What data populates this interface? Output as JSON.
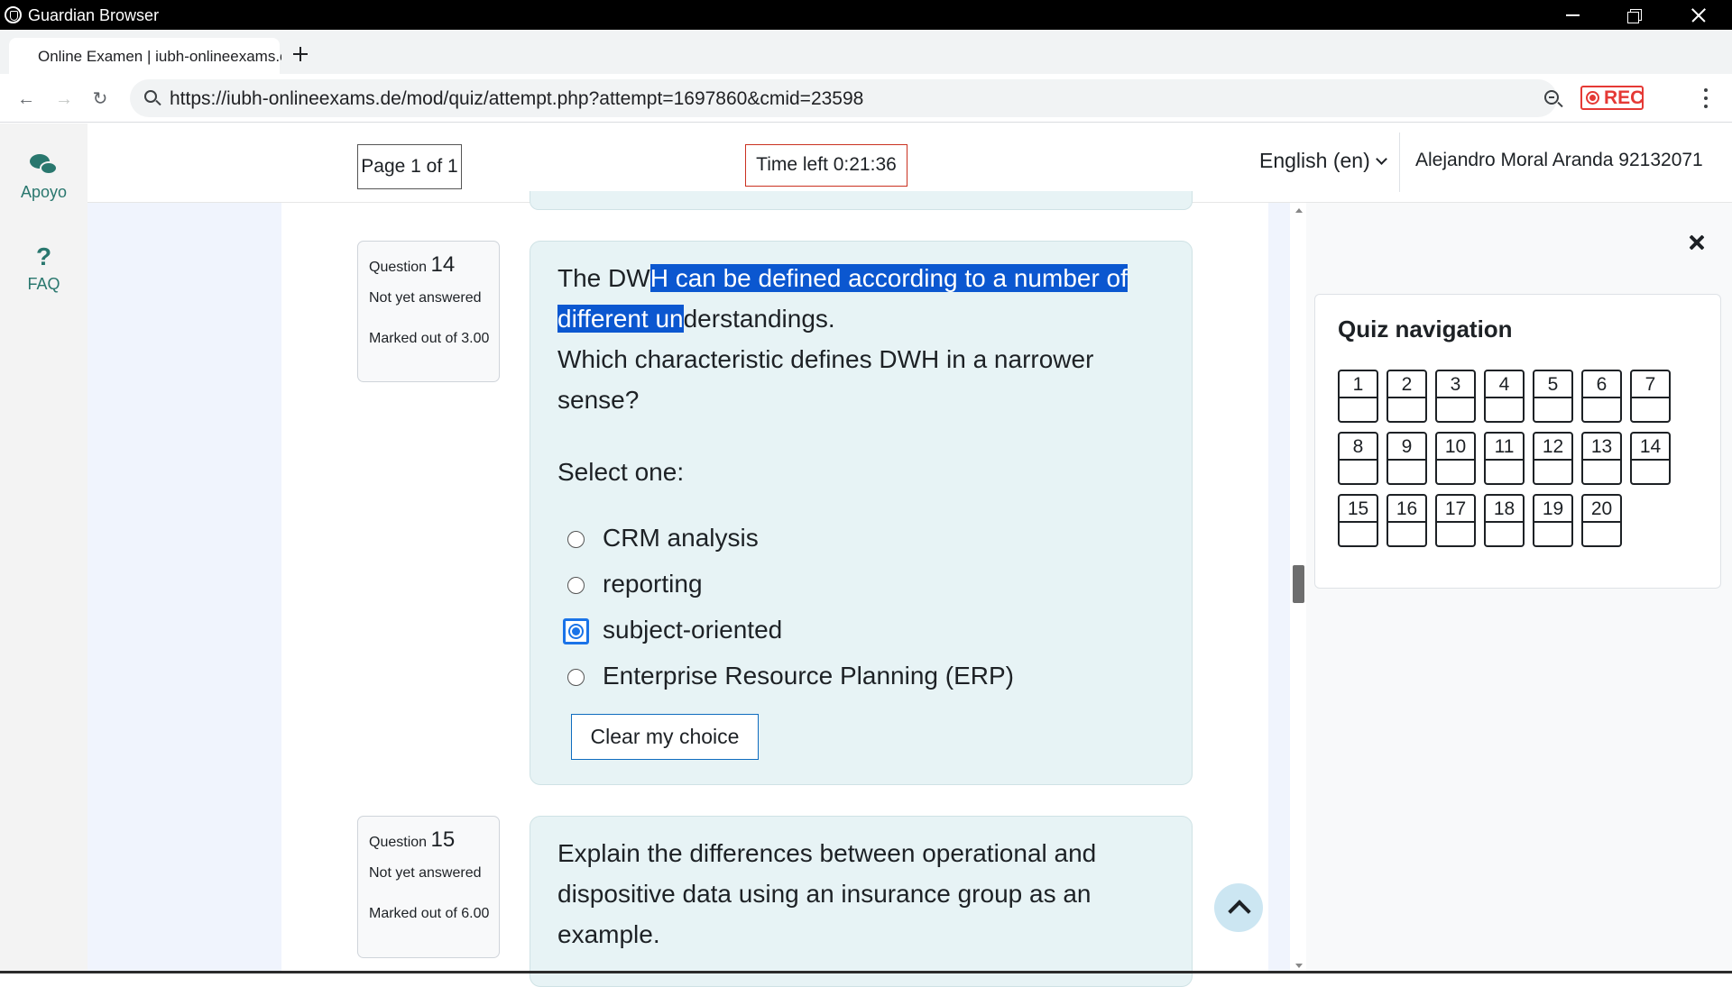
{
  "window": {
    "title": "Guardian Browser"
  },
  "tab": {
    "title": "Online Examen | iubh-onlineexams.c"
  },
  "address": {
    "url": "https://iubh-onlineexams.de/mod/quiz/attempt.php?attempt=1697860&cmid=23598",
    "rec_label": "REC"
  },
  "support": {
    "items": [
      {
        "label": "Apoyo",
        "icon": "chat-icon"
      },
      {
        "label": "FAQ",
        "icon": "question-icon"
      }
    ]
  },
  "header": {
    "page_info": "Page 1 of 1",
    "time_left": "Time left 0:21:36",
    "language": "English (en)",
    "user": "Alejandro Moral Aranda 92132071"
  },
  "questions": [
    {
      "label": "Question",
      "number": "14",
      "state": "Not yet answered",
      "grade": "Marked out of 3.00",
      "text_before": "The DW",
      "text_selected": "H can be defined according to a number of different un",
      "text_after": "derstandings.",
      "text_line2": "Which characteristic defines DWH in a narrower sense?",
      "prompt": "Select one:",
      "options": [
        {
          "label": "CRM analysis",
          "selected": false
        },
        {
          "label": "reporting",
          "selected": false
        },
        {
          "label": "subject-oriented",
          "selected": true
        },
        {
          "label": "Enterprise Resource Planning (ERP)",
          "selected": false
        }
      ],
      "clear_label": "Clear my choice"
    },
    {
      "label": "Question",
      "number": "15",
      "state": "Not yet answered",
      "grade": "Marked out of 6.00",
      "text": "Explain the differences between operational and dispositive data using an insurance group as an example."
    }
  ],
  "quiz_nav": {
    "title": "Quiz navigation",
    "buttons": [
      "1",
      "2",
      "3",
      "4",
      "5",
      "6",
      "7",
      "8",
      "9",
      "10",
      "11",
      "12",
      "13",
      "14",
      "15",
      "16",
      "17",
      "18",
      "19",
      "20"
    ]
  },
  "colors": {
    "accent": "#29776e",
    "timer_border": "#ca3120",
    "selection": "#0b57d0",
    "rec": "#e53935"
  }
}
